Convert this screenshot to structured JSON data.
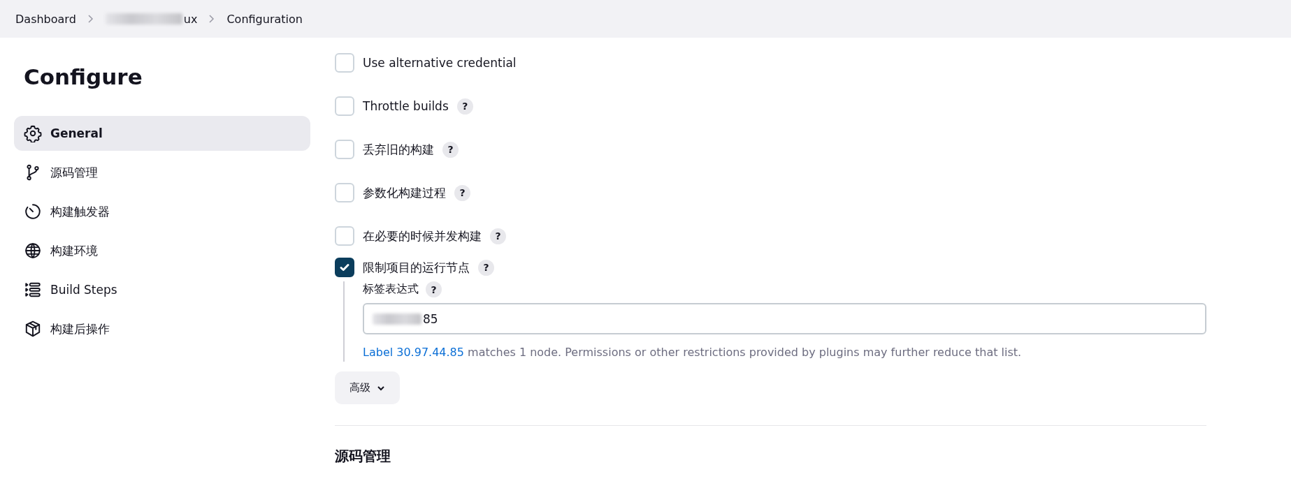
{
  "breadcrumb": [
    {
      "label": "Dashboard",
      "blurred": false
    },
    {
      "label": "ux",
      "blurred": true
    },
    {
      "label": "Configuration",
      "blurred": false
    }
  ],
  "sidebar": {
    "title": "Configure",
    "items": [
      {
        "label": "General",
        "selected": true
      },
      {
        "label": "源码管理",
        "selected": false
      },
      {
        "label": "构建触发器",
        "selected": false
      },
      {
        "label": "构建环境",
        "selected": false
      },
      {
        "label": "Build Steps",
        "selected": false
      },
      {
        "label": "构建后操作",
        "selected": false
      }
    ]
  },
  "options": [
    {
      "label": "Use alternative credential",
      "checked": false
    },
    {
      "label": "Throttle builds",
      "checked": false,
      "help": "?"
    },
    {
      "label": "丢弃旧的构建",
      "checked": false,
      "help": "?"
    },
    {
      "label": "参数化构建过程",
      "checked": false,
      "help": "?"
    },
    {
      "label": "在必要的时候并发构建",
      "checked": false,
      "help": "?"
    },
    {
      "label": "限制项目的运行节点",
      "checked": true,
      "help": "?"
    }
  ],
  "label_expression": {
    "label": "标签表达式",
    "help": "?",
    "value": "85",
    "value_blurred": true,
    "link": "Label 30.97.44.85",
    "message": " matches 1 node. Permissions or other restrictions provided by plugins may further reduce that list."
  },
  "advanced_button": "高级",
  "section_heading": "源码管理"
}
